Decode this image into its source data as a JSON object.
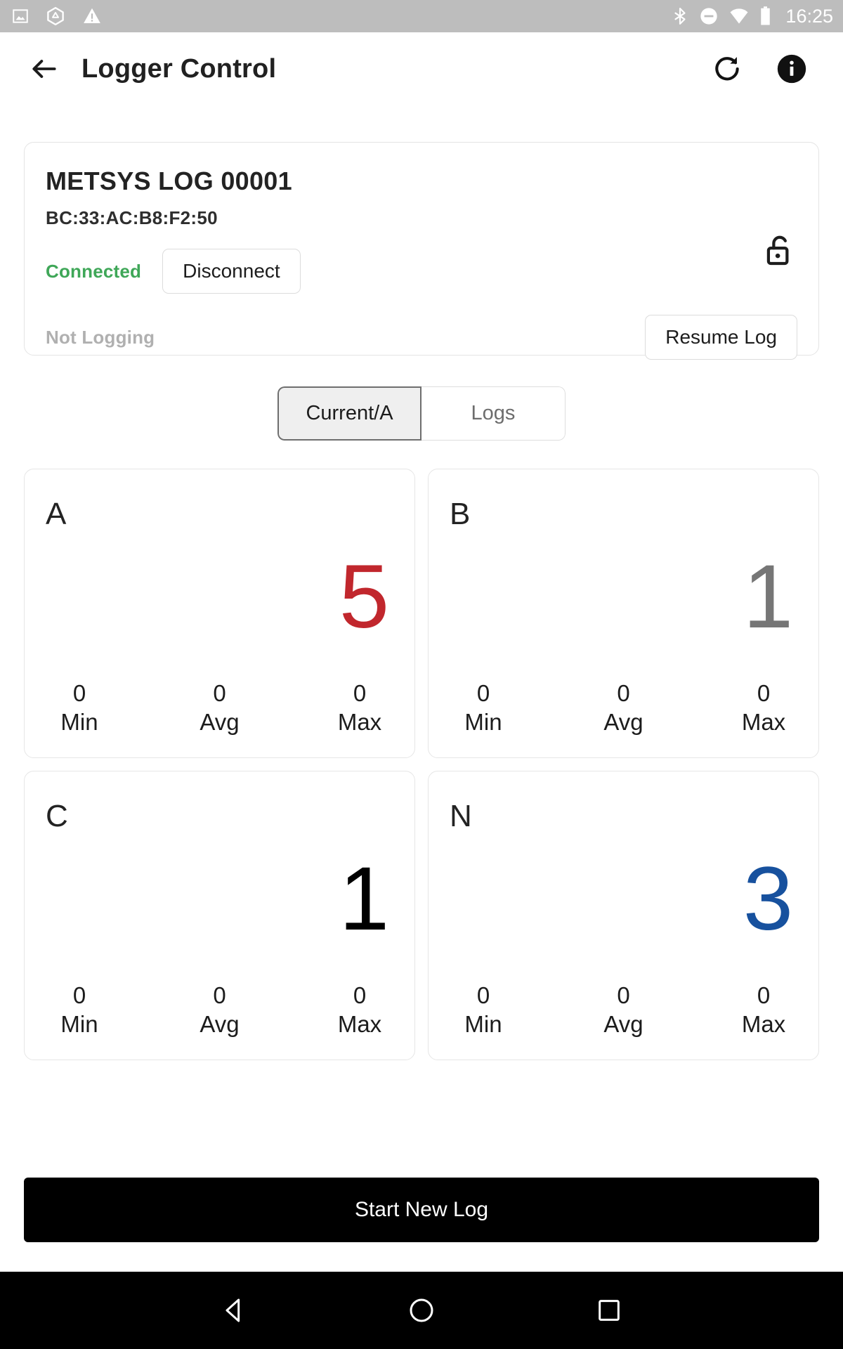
{
  "status_bar": {
    "time": "16:25",
    "left_icons": [
      "image-icon",
      "drive-icon",
      "warning-icon"
    ],
    "right_icons": [
      "bluetooth-icon",
      "do-not-disturb-icon",
      "wifi-icon",
      "battery-icon"
    ],
    "background": "#bdbdbd"
  },
  "appbar": {
    "back_icon": "back-arrow-icon",
    "title": "Logger Control",
    "refresh_icon": "refresh-icon",
    "info_icon": "info-icon"
  },
  "device": {
    "name": "METSYS LOG 00001",
    "mac": "BC:33:AC:B8:F2:50",
    "connection_status": "Connected",
    "connection_status_color": "#3fa758",
    "disconnect_label": "Disconnect",
    "lock_icon": "unlocked-padlock-icon",
    "log_status": "Not Logging",
    "log_status_color": "#b0b0b0",
    "resume_label": "Resume Log"
  },
  "tabs": {
    "selected_index": 0,
    "items": [
      {
        "label": "Current/A"
      },
      {
        "label": "Logs"
      }
    ]
  },
  "measurements": {
    "stat_labels": {
      "min": "Min",
      "avg": "Avg",
      "max": "Max"
    },
    "cards": [
      {
        "phase": "A",
        "value": "5",
        "value_color": "#c1272d",
        "min": "0",
        "avg": "0",
        "max": "0"
      },
      {
        "phase": "B",
        "value": "1",
        "value_color": "#767676",
        "min": "0",
        "avg": "0",
        "max": "0"
      },
      {
        "phase": "C",
        "value": "1",
        "value_color": "#000000",
        "min": "0",
        "avg": "0",
        "max": "0"
      },
      {
        "phase": "N",
        "value": "3",
        "value_color": "#17519e",
        "min": "0",
        "avg": "0",
        "max": "0"
      }
    ]
  },
  "bottom_action": {
    "label": "Start New Log",
    "background": "#000000"
  },
  "navbar": {
    "back_icon": "nav-back-icon",
    "home_icon": "nav-home-icon",
    "recents_icon": "nav-recents-icon"
  }
}
